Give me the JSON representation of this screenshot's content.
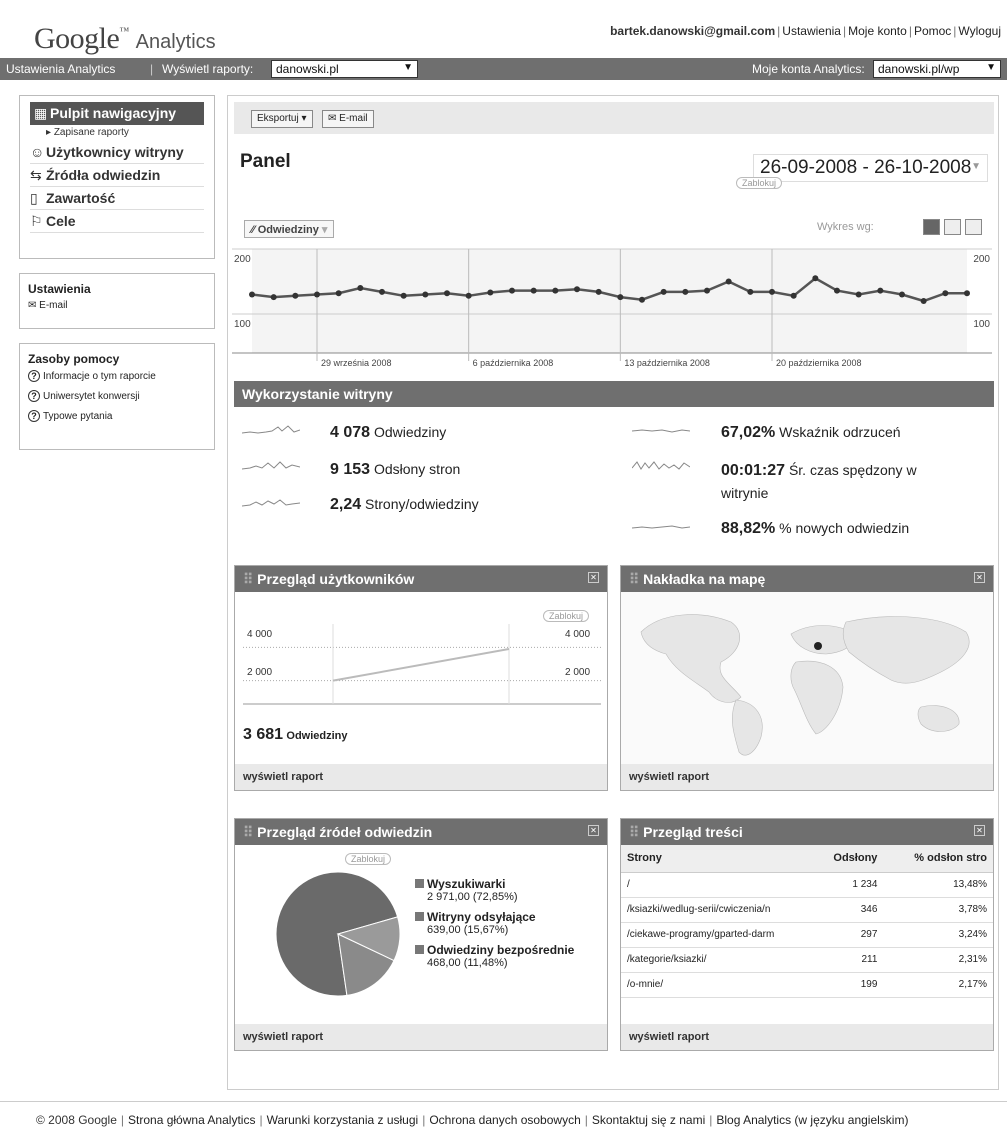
{
  "header": {
    "logo_google": "Google",
    "logo_product": "Analytics",
    "user_email": "bartek.danowski@gmail.com",
    "links": [
      "Ustawienia",
      "Moje konto",
      "Pomoc",
      "Wyloguj"
    ]
  },
  "topbar": {
    "settings_link": "Ustawienia Analytics",
    "view_reports_label": "Wyświetl raporty:",
    "view_reports_value": "danowski.pl",
    "accounts_label": "Moje konta Analytics:",
    "accounts_value": "danowski.pl/wp"
  },
  "sidebar": {
    "dashboard": "Pulpit nawigacyjny",
    "saved_reports": "Zapisane raporty",
    "items": [
      "Użytkownicy witryny",
      "Źródła odwiedzin",
      "Zawartość",
      "Cele"
    ],
    "settings_title": "Ustawienia",
    "settings_email": "E-mail",
    "help_title": "Zasoby pomocy",
    "help_links": [
      "Informacje o tym raporcie",
      "Uniwersytet konwersji",
      "Typowe pytania"
    ]
  },
  "toolbar": {
    "export": "Eksportuj",
    "email": "E-mail"
  },
  "panel": {
    "title": "Panel",
    "date_range": "26-09-2008 - 26-10-2008",
    "lock_label": "Zablokuj",
    "metric_select": "Odwiedziny",
    "graph_by": "Wykres wg:"
  },
  "chart_data": [
    {
      "type": "line",
      "series": [
        {
          "name": "Odwiedziny",
          "values": [
            130,
            126,
            128,
            130,
            132,
            140,
            134,
            128,
            130,
            132,
            128,
            133,
            136,
            136,
            136,
            138,
            134,
            126,
            122,
            134,
            134,
            136,
            150,
            134,
            134,
            128,
            155,
            136,
            130,
            136,
            130,
            120,
            132,
            132
          ]
        }
      ],
      "yticks": [
        100,
        200
      ],
      "ylim": [
        40,
        200
      ],
      "xticks": [
        "29 września 2008",
        "6 października 2008",
        "13 października 2008",
        "20 października 2008"
      ],
      "grid": true
    },
    {
      "type": "line",
      "title": "Przegląd użytkowników",
      "x": [
        0,
        1
      ],
      "values": [
        1400,
        3300
      ],
      "yticks": [
        "2 000",
        "4 000"
      ],
      "ylim": [
        0,
        4800
      ]
    },
    {
      "type": "pie",
      "title": "Przegląd źródeł odwiedzin",
      "categories": [
        "Wyszukiwarki",
        "Witryny odsyłające",
        "Odwiedziny bezpośrednie"
      ],
      "values": [
        72.85,
        15.67,
        11.48
      ]
    }
  ],
  "usage": {
    "title": "Wykorzystanie witryny",
    "visits_value": "4 078",
    "visits_label": "Odwiedziny",
    "pageviews_value": "9 153",
    "pageviews_label": "Odsłony stron",
    "pps_value": "2,24",
    "pps_label": "Strony/odwiedziny",
    "bounce_value": "67,02%",
    "bounce_label": "Wskaźnik odrzuceń",
    "time_value": "00:01:27",
    "time_label": "Śr. czas spędzony w",
    "time_label2": "witrynie",
    "new_value": "88,82%",
    "new_label": "% nowych odwiedzin"
  },
  "users_widget": {
    "title": "Przegląd użytkowników",
    "lock": "Zablokuj",
    "y_high": "4 000",
    "y_low": "2 000",
    "total_value": "3 681",
    "total_label": "Odwiedziny",
    "footer": "wyświetl raport"
  },
  "map_widget": {
    "title": "Nakładka na mapę",
    "footer": "wyświetl raport"
  },
  "sources_widget": {
    "title": "Przegląd źródeł odwiedzin",
    "lock": "Zablokuj",
    "legend": [
      {
        "label": "Wyszukiwarki",
        "value": "2 971,00 (72,85%)"
      },
      {
        "label": "Witryny odsyłające",
        "value": "639,00 (15,67%)"
      },
      {
        "label": "Odwiedziny bezpośrednie",
        "value": "468,00 (11,48%)"
      }
    ],
    "footer": "wyświetl raport"
  },
  "content_widget": {
    "title": "Przegląd treści",
    "columns": [
      "Strony",
      "Odsłony",
      "% odsłon stro"
    ],
    "rows": [
      [
        "/",
        "1 234",
        "13,48%"
      ],
      [
        "/ksiazki/wedlug-serii/cwiczenia/n",
        "346",
        "3,78%"
      ],
      [
        "/ciekawe-programy/gparted-darm",
        "297",
        "3,24%"
      ],
      [
        "/kategorie/ksiazki/",
        "211",
        "2,31%"
      ],
      [
        "/o-mnie/",
        "199",
        "2,17%"
      ]
    ],
    "footer": "wyświetl raport"
  },
  "footer": {
    "copyright": "© 2008 Google",
    "links": [
      "Strona główna Analytics",
      "Warunki korzystania z usługi",
      "Ochrona danych osobowych",
      "Skontaktuj się z nami",
      "Blog Analytics (w języku angielskim)"
    ]
  }
}
